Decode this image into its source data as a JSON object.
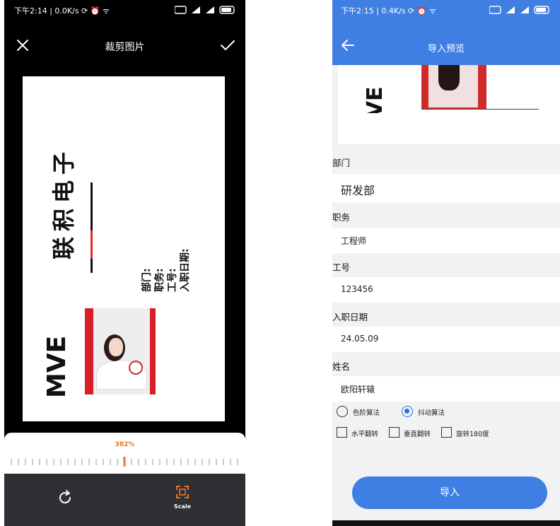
{
  "left": {
    "status": {
      "text": "下午2:14 | 0.0K/s ⟳ ⏰ ᯤ"
    },
    "title": "裁剪图片",
    "zoom_percent": "382%",
    "zoom_level": 3.82,
    "toolbar": {
      "scale_label": "Scale"
    },
    "card": {
      "title_chars": [
        "子",
        "电",
        "积",
        "联"
      ],
      "field_labels": [
        "部门:",
        "职务:",
        "工号:",
        "入职日期:"
      ],
      "logo": "MVE"
    },
    "icons": {
      "close": "close-icon",
      "confirm": "check-icon",
      "rotate": "rotate-icon",
      "scale": "scale-icon"
    }
  },
  "right": {
    "status": {
      "text": "下午2:15 | 0.4K/s ⟳ ⏰ ᯤ"
    },
    "title": "导入预览",
    "fields": [
      {
        "label": "部门",
        "value": "研发部"
      },
      {
        "label": "职务",
        "value": "工程师"
      },
      {
        "label": "工号",
        "value": "123456"
      },
      {
        "label": "入职日期",
        "value": "24.05.09"
      },
      {
        "label": "姓名",
        "value": "欧阳轩辕"
      }
    ],
    "algorithms": [
      {
        "label": "色阶算法",
        "selected": false
      },
      {
        "label": "抖动算法",
        "selected": true
      }
    ],
    "transforms": [
      {
        "label": "水平翻转",
        "checked": false
      },
      {
        "label": "垂直翻转",
        "checked": false
      },
      {
        "label": "旋转180度",
        "checked": false
      }
    ],
    "import_label": "导入",
    "preview_logo": "MVE",
    "icons": {
      "back": "back-arrow-icon"
    },
    "accent_color": "#3f7ee2"
  }
}
